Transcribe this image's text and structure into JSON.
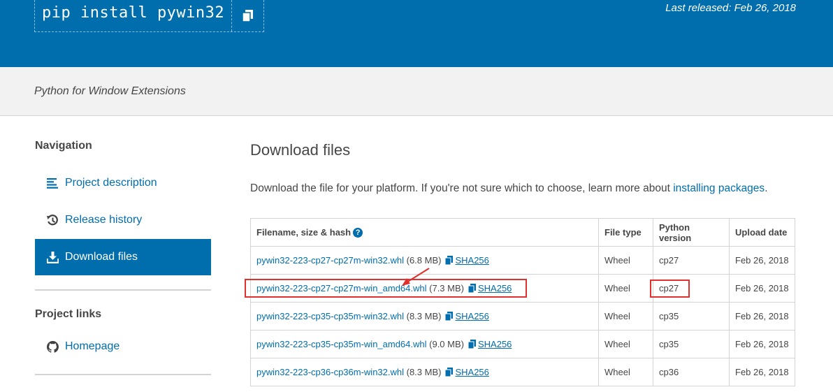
{
  "header": {
    "pip_command": "pip install pywin32",
    "last_released": "Last released: Feb 26, 2018",
    "accent": "#006dad"
  },
  "summary": "Python for Window Extensions",
  "sidebar": {
    "navigation_heading": "Navigation",
    "nav_items": [
      {
        "label": "Project description",
        "icon": "list-icon"
      },
      {
        "label": "Release history",
        "icon": "history-icon"
      },
      {
        "label": "Download files",
        "icon": "download-icon",
        "active": true
      }
    ],
    "project_links_heading": "Project links",
    "links": [
      {
        "label": "Homepage",
        "icon": "github-icon"
      }
    ]
  },
  "main": {
    "title": "Download files",
    "intro": "Download the file for your platform. If you're not sure which to choose, learn more about ",
    "intro_link": "installing packages",
    "intro_end": ".",
    "table": {
      "headers": [
        "Filename, size & hash",
        "File type",
        "Python version",
        "Upload date"
      ],
      "rows": [
        {
          "filename": "pywin32-223-cp27-cp27m-win32.whl",
          "size": "(6.8 MB)",
          "hash": "SHA256",
          "type": "Wheel",
          "python": "cp27",
          "date": "Feb 26, 2018"
        },
        {
          "filename": "pywin32-223-cp27-cp27m-win_amd64.whl",
          "size": "(7.3 MB)",
          "hash": "SHA256",
          "type": "Wheel",
          "python": "cp27",
          "date": "Feb 26, 2018"
        },
        {
          "filename": "pywin32-223-cp35-cp35m-win32.whl",
          "size": "(8.3 MB)",
          "hash": "SHA256",
          "type": "Wheel",
          "python": "cp35",
          "date": "Feb 26, 2018"
        },
        {
          "filename": "pywin32-223-cp35-cp35m-win_amd64.whl",
          "size": "(9.0 MB)",
          "hash": "SHA256",
          "type": "Wheel",
          "python": "cp35",
          "date": "Feb 26, 2018"
        },
        {
          "filename": "pywin32-223-cp36-cp36m-win32.whl",
          "size": "(8.3 MB)",
          "hash": "SHA256",
          "type": "Wheel",
          "python": "cp36",
          "date": "Feb 26, 2018"
        }
      ]
    }
  },
  "annotation_color": "#e0312f"
}
